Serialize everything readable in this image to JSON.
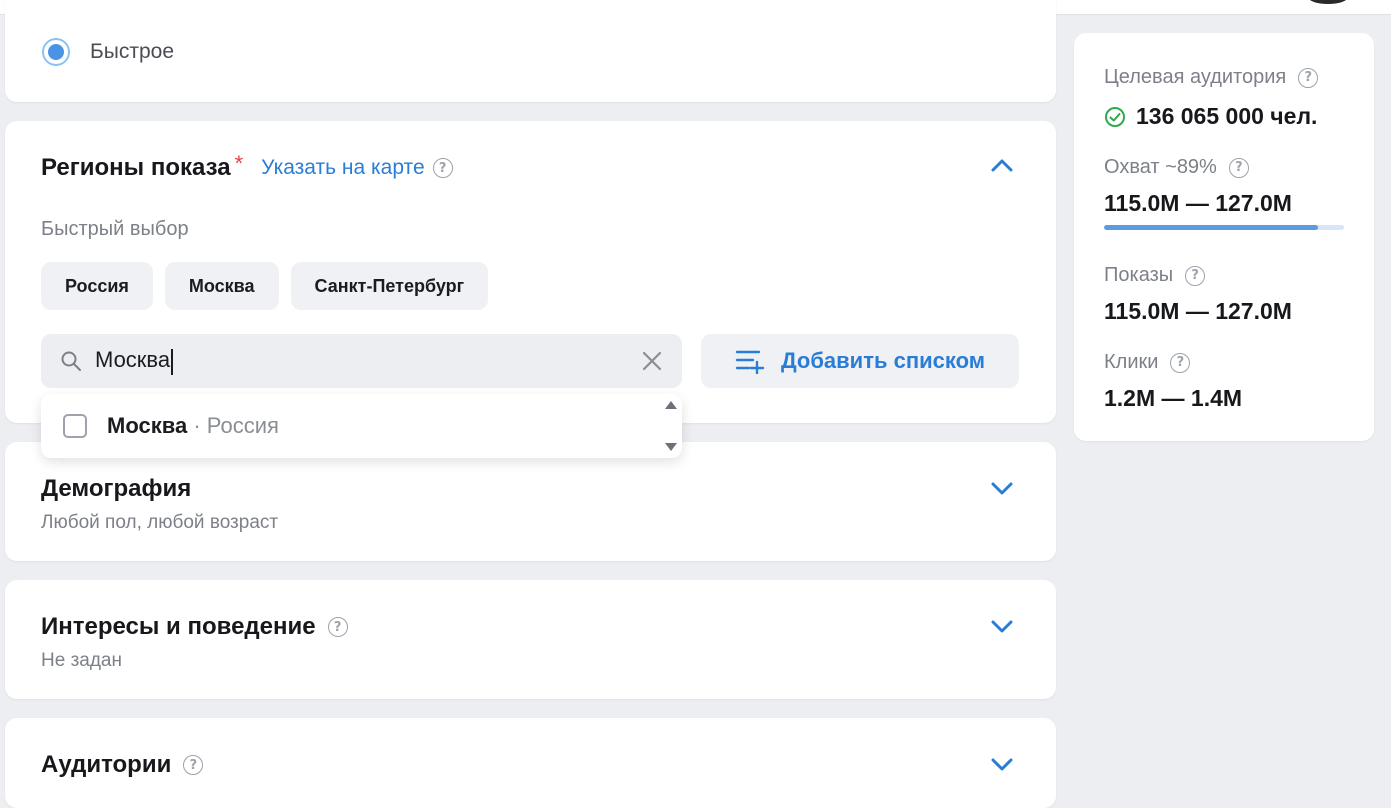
{
  "speed": {
    "option_label": "Быстрое"
  },
  "regions": {
    "title": "Регионы показа",
    "required_mark": "*",
    "map_link": "Указать на карте",
    "quick_label": "Быстрый выбор",
    "chips": [
      "Россия",
      "Москва",
      "Санкт-Петербург"
    ],
    "search_value": "Москва",
    "add_list_label": "Добавить списком",
    "suggestion": {
      "name": "Москва",
      "country": "· Россия"
    }
  },
  "demography": {
    "title": "Демография",
    "subtitle": "Любой пол, любой возраст"
  },
  "interests": {
    "title": "Интересы и поведение",
    "subtitle": "Не задан"
  },
  "audiences": {
    "title": "Аудитории"
  },
  "sidebar": {
    "audience_label": "Целевая аудитория",
    "audience_value": "136 065 000 чел.",
    "reach_label": "Охват ~89%",
    "reach_value": "115.0M — 127.0M",
    "reach_progress": 0.89,
    "impressions_label": "Показы",
    "impressions_value": "115.0M — 127.0M",
    "clicks_label": "Клики",
    "clicks_value": "1.2M — 1.4M"
  },
  "icons": {
    "help": "question-circle-icon",
    "chevron": "chevron-icon",
    "search": "search-icon",
    "clear": "close-icon",
    "add_list": "list-add-icon",
    "check": "check-circle-icon"
  },
  "colors": {
    "accent": "#2a7dd6",
    "required": "#e04545",
    "success": "#2fa84f"
  }
}
